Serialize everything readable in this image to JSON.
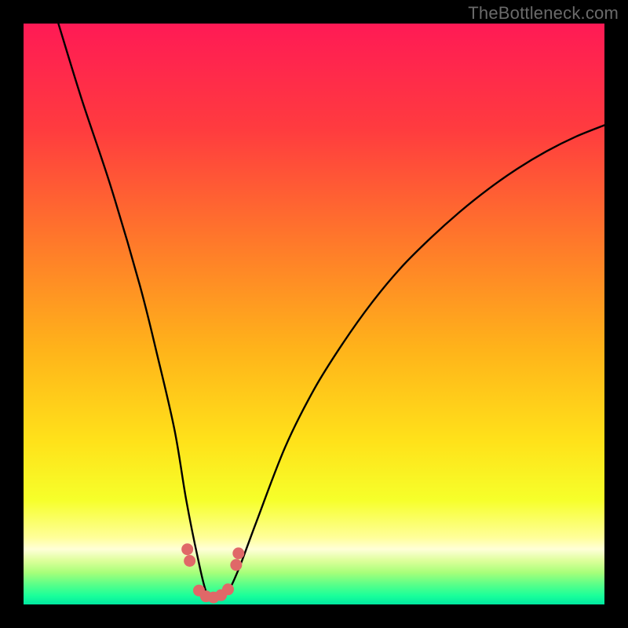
{
  "watermark": "TheBottleneck.com",
  "gradient_stops": [
    {
      "offset": 0.0,
      "color": "#ff1a55"
    },
    {
      "offset": 0.18,
      "color": "#ff3b3f"
    },
    {
      "offset": 0.38,
      "color": "#ff7a2a"
    },
    {
      "offset": 0.56,
      "color": "#ffb31a"
    },
    {
      "offset": 0.72,
      "color": "#ffe21a"
    },
    {
      "offset": 0.82,
      "color": "#f6ff2a"
    },
    {
      "offset": 0.885,
      "color": "#ffff9a"
    },
    {
      "offset": 0.905,
      "color": "#ffffd8"
    },
    {
      "offset": 0.925,
      "color": "#dcff9a"
    },
    {
      "offset": 0.945,
      "color": "#a8ff7a"
    },
    {
      "offset": 0.965,
      "color": "#5cff88"
    },
    {
      "offset": 0.985,
      "color": "#1aff9a"
    },
    {
      "offset": 1.0,
      "color": "#00e8a0"
    }
  ],
  "marker_color": "#e06868",
  "chart_data": {
    "type": "line",
    "title": "",
    "xlabel": "",
    "ylabel": "",
    "xlim": [
      0,
      100
    ],
    "ylim": [
      0,
      100
    ],
    "series": [
      {
        "name": "bottleneck-curve",
        "x": [
          6,
          10,
          15,
          20,
          23,
          26,
          28,
          30,
          31.5,
          33,
          35,
          37,
          40,
          45,
          50,
          55,
          60,
          65,
          70,
          75,
          80,
          85,
          90,
          95,
          100
        ],
        "y": [
          100,
          87,
          72,
          55,
          43,
          30,
          18,
          8,
          2,
          1,
          2,
          6,
          14,
          27,
          37,
          45,
          52,
          58,
          63,
          67.5,
          71.5,
          75,
          78,
          80.5,
          82.5
        ]
      }
    ],
    "markers": {
      "name": "highlight-points",
      "x": [
        28.2,
        28.6,
        30.2,
        31.4,
        32.7,
        34.0,
        35.2,
        36.6,
        37.0
      ],
      "y": [
        9.5,
        7.5,
        2.4,
        1.4,
        1.2,
        1.6,
        2.6,
        6.8,
        8.8
      ]
    }
  }
}
